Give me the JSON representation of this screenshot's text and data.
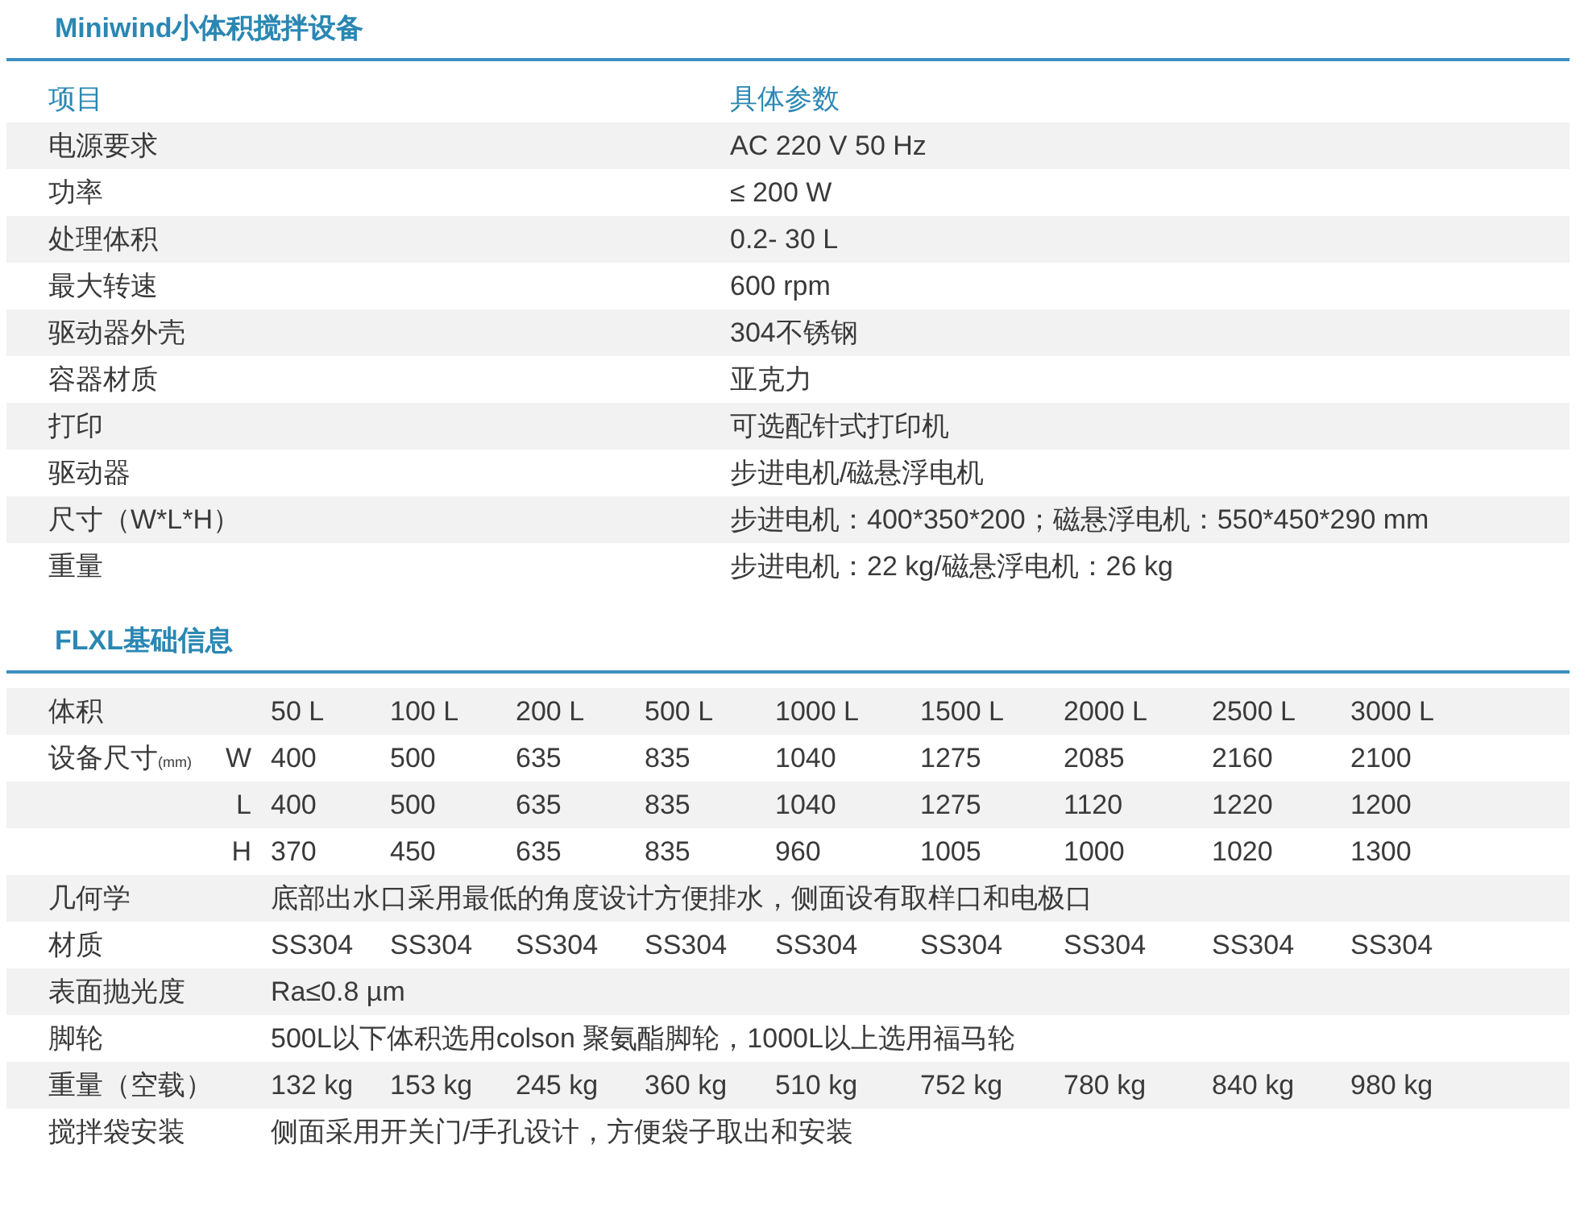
{
  "sections": [
    {
      "title": "Miniwind小体积搅拌设备",
      "kind": "spec",
      "header": {
        "item": "项目",
        "value": "具体参数"
      },
      "rows": [
        {
          "item": "电源要求",
          "value": "AC 220  V 50 Hz"
        },
        {
          "item": "功率",
          "value": "≤ 200 W"
        },
        {
          "item": "处理体积",
          "value": "0.2- 30 L"
        },
        {
          "item": "最大转速",
          "value": "600  rpm"
        },
        {
          "item": "驱动器外壳",
          "value": "304不锈钢"
        },
        {
          "item": "容器材质",
          "value": "亚克力"
        },
        {
          "item": "打印",
          "value": "可选配针式打印机"
        },
        {
          "item": "驱动器",
          "value": "步进电机/磁悬浮电机"
        },
        {
          "item": "尺寸（W*L*H）",
          "value": "步进电机：400*350*200；磁悬浮电机：550*450*290 mm"
        },
        {
          "item": "重量",
          "value": "步进电机：22 kg/磁悬浮电机：26 kg"
        }
      ]
    },
    {
      "title": "FLXL基础信息",
      "kind": "grid",
      "rows": [
        {
          "kind": "values",
          "label": "体积",
          "values": [
            "50 L",
            "100 L",
            "200 L",
            "500 L",
            "1000 L",
            "1500 L",
            "2000 L",
            "2500 L",
            "3000 L"
          ]
        },
        {
          "kind": "values",
          "label": "设备尺寸",
          "unit": "(mm)",
          "sub": "W",
          "values": [
            "400",
            "500",
            "635",
            "835",
            "1040",
            "1275",
            "2085",
            "2160",
            "2100"
          ]
        },
        {
          "kind": "values",
          "sub": "L",
          "values": [
            "400",
            "500",
            "635",
            "835",
            "1040",
            "1275",
            "1120",
            "1220",
            "1200"
          ]
        },
        {
          "kind": "values",
          "sub": "H",
          "values": [
            "370",
            "450",
            "635",
            "835",
            "960",
            "1005",
            "1000",
            "1020",
            "1300"
          ]
        },
        {
          "kind": "text",
          "label": "几何学",
          "text": "底部出水口采用最低的角度设计方便排水，侧面设有取样口和电极口"
        },
        {
          "kind": "values",
          "label": "材质",
          "values": [
            "SS304",
            "SS304",
            "SS304",
            "SS304",
            "SS304",
            "SS304",
            "SS304",
            "SS304",
            "SS304"
          ]
        },
        {
          "kind": "text",
          "label": "表面抛光度",
          "text": "Ra≤0.8 µm"
        },
        {
          "kind": "text",
          "label": "脚轮",
          "text": "500L以下体积选用colson 聚氨酯脚轮，1000L以上选用福马轮"
        },
        {
          "kind": "values",
          "label": "重量（空载）",
          "values": [
            "132 kg",
            "153 kg",
            "245 kg",
            "360 kg",
            "510 kg",
            "752 kg",
            "780 kg",
            "840 kg",
            "980 kg"
          ]
        },
        {
          "kind": "text",
          "label": "搅拌袋安装",
          "text": "侧面采用开关门/手孔设计，方便袋子取出和安装"
        }
      ]
    }
  ]
}
